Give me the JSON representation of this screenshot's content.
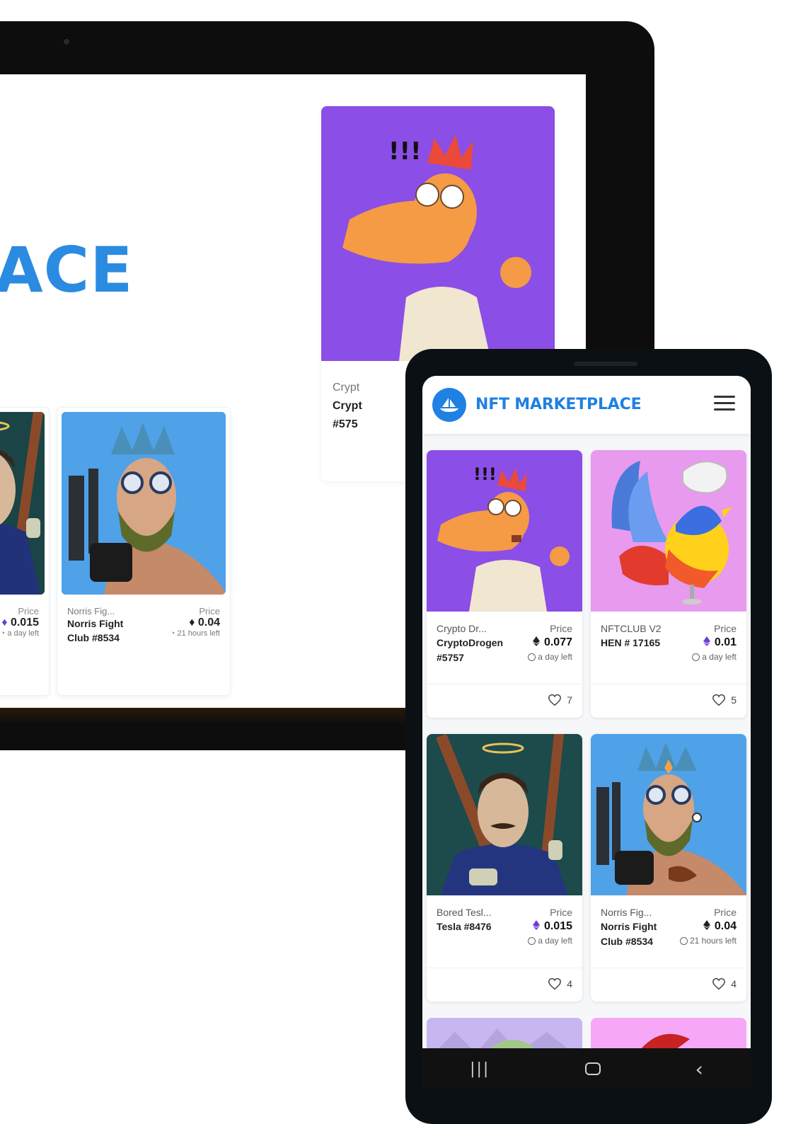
{
  "tablet": {
    "heading": "PLACE",
    "big_card": {
      "collection": "Crypt",
      "title": "Crypt",
      "id": "#575"
    },
    "cards": [
      {
        "price_label": "Price",
        "price": "0.015",
        "time": "a day left"
      },
      {
        "collection": "Norris Fig...",
        "title": "Norris Fight Club #8534",
        "price_label": "Price",
        "price": "0.04",
        "time": "21 hours left"
      }
    ]
  },
  "app": {
    "title": "NFT MARKETPLACE",
    "logo_icon": "sailboat-icon",
    "menu_icon": "hamburger-menu-icon",
    "accent": "#2081e2"
  },
  "cards": [
    {
      "collection": "Crypto Dr...",
      "title": "CryptoDrogen #5757",
      "price_label": "Price",
      "price": "0.077",
      "time": "a day left",
      "likes": "7"
    },
    {
      "collection": "NFTCLUB V2",
      "title": "HEN # 17165",
      "price_label": "Price",
      "price": "0.01",
      "time": "a day left",
      "likes": "5"
    },
    {
      "collection": "Bored Tesl...",
      "title": "Tesla #8476",
      "price_label": "Price",
      "price": "0.015",
      "time": "a day left",
      "likes": "4"
    },
    {
      "collection": "Norris Fig...",
      "title": "Norris Fight Club #8534",
      "price_label": "Price",
      "price": "0.04",
      "time": "21 hours left",
      "likes": "4"
    }
  ],
  "navbar": {
    "recents": "|||",
    "home_icon": "home-icon",
    "back": "‹"
  }
}
